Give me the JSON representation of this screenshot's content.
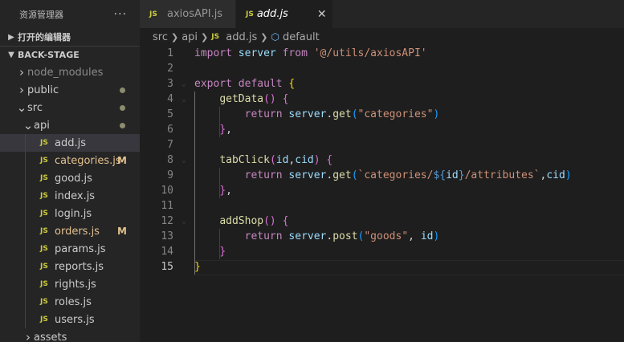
{
  "sidebar": {
    "title": "资源管理器",
    "more": "···",
    "open_editors": "打开的编辑器",
    "project": "BACK-STAGE",
    "tree": [
      {
        "label": "node_modules",
        "type": "folder",
        "depth": 0,
        "expanded": false,
        "muted": true
      },
      {
        "label": "public",
        "type": "folder",
        "depth": 0,
        "expanded": false,
        "dot": true
      },
      {
        "label": "src",
        "type": "folder",
        "depth": 0,
        "expanded": true,
        "dot": true
      },
      {
        "label": "api",
        "type": "folder",
        "depth": 1,
        "expanded": true,
        "dot": true
      },
      {
        "label": "add.js",
        "type": "js",
        "depth": 2,
        "selected": true
      },
      {
        "label": "categories.js",
        "type": "js",
        "depth": 2,
        "modified": true,
        "badge": "M"
      },
      {
        "label": "good.js",
        "type": "js",
        "depth": 2
      },
      {
        "label": "index.js",
        "type": "js",
        "depth": 2
      },
      {
        "label": "login.js",
        "type": "js",
        "depth": 2
      },
      {
        "label": "orders.js",
        "type": "js",
        "depth": 2,
        "modified": true,
        "badge": "M"
      },
      {
        "label": "params.js",
        "type": "js",
        "depth": 2
      },
      {
        "label": "reports.js",
        "type": "js",
        "depth": 2
      },
      {
        "label": "rights.js",
        "type": "js",
        "depth": 2
      },
      {
        "label": "roles.js",
        "type": "js",
        "depth": 2
      },
      {
        "label": "users.js",
        "type": "js",
        "depth": 2
      },
      {
        "label": "assets",
        "type": "folder",
        "depth": 1,
        "expanded": false
      }
    ]
  },
  "tabs": [
    {
      "icon": "JS",
      "label": "axiosAPI.js",
      "active": false
    },
    {
      "icon": "JS",
      "label": "add.js",
      "active": true,
      "close": "✕"
    }
  ],
  "breadcrumb": {
    "parts": [
      "src",
      "api",
      "add.js",
      "default"
    ],
    "js_icon": "JS"
  },
  "code": {
    "current_line": 15,
    "lines": [
      {
        "n": "1",
        "tokens": [
          [
            "kw",
            "import"
          ],
          [
            "op",
            " "
          ],
          [
            "var",
            "server"
          ],
          [
            "op",
            " "
          ],
          [
            "kw",
            "from"
          ],
          [
            "op",
            " "
          ],
          [
            "str",
            "'@/utils/axiosAPI'"
          ]
        ]
      },
      {
        "n": "2",
        "tokens": []
      },
      {
        "n": "3",
        "fold": true,
        "tokens": [
          [
            "kw",
            "export"
          ],
          [
            "op",
            " "
          ],
          [
            "kw",
            "default"
          ],
          [
            "op",
            " "
          ],
          [
            "br1",
            "{"
          ]
        ]
      },
      {
        "n": "4",
        "fold": true,
        "tokens": [
          [
            "op",
            "    "
          ],
          [
            "fn",
            "getData"
          ],
          [
            "br2",
            "()"
          ],
          [
            "op",
            " "
          ],
          [
            "br2",
            "{"
          ]
        ]
      },
      {
        "n": "5",
        "tokens": [
          [
            "op",
            "        "
          ],
          [
            "ctl",
            "return"
          ],
          [
            "op",
            " "
          ],
          [
            "var",
            "server"
          ],
          [
            "op",
            "."
          ],
          [
            "fn",
            "get"
          ],
          [
            "br3",
            "("
          ],
          [
            "str",
            "\"categories\""
          ],
          [
            "br3",
            ")"
          ]
        ]
      },
      {
        "n": "6",
        "tokens": [
          [
            "op",
            "    "
          ],
          [
            "br2",
            "}"
          ],
          [
            "op",
            ","
          ]
        ]
      },
      {
        "n": "7",
        "tokens": []
      },
      {
        "n": "8",
        "fold": true,
        "tokens": [
          [
            "op",
            "    "
          ],
          [
            "fn",
            "tabClick"
          ],
          [
            "br2",
            "("
          ],
          [
            "var",
            "id"
          ],
          [
            "op",
            ","
          ],
          [
            "var",
            "cid"
          ],
          [
            "br2",
            ")"
          ],
          [
            "op",
            " "
          ],
          [
            "br2",
            "{"
          ]
        ]
      },
      {
        "n": "9",
        "tokens": [
          [
            "op",
            "        "
          ],
          [
            "ctl",
            "return"
          ],
          [
            "op",
            " "
          ],
          [
            "var",
            "server"
          ],
          [
            "op",
            "."
          ],
          [
            "fn",
            "get"
          ],
          [
            "br3",
            "("
          ],
          [
            "str",
            "`categories/"
          ],
          [
            "tmpl",
            "${"
          ],
          [
            "var",
            "id"
          ],
          [
            "tmpl",
            "}"
          ],
          [
            "str",
            "/attributes`"
          ],
          [
            "op",
            ","
          ],
          [
            "var",
            "cid"
          ],
          [
            "br3",
            ")"
          ]
        ]
      },
      {
        "n": "10",
        "tokens": [
          [
            "op",
            "    "
          ],
          [
            "br2",
            "}"
          ],
          [
            "op",
            ","
          ]
        ]
      },
      {
        "n": "11",
        "tokens": []
      },
      {
        "n": "12",
        "fold": true,
        "tokens": [
          [
            "op",
            "    "
          ],
          [
            "fn",
            "addShop"
          ],
          [
            "br2",
            "()"
          ],
          [
            "op",
            " "
          ],
          [
            "br2",
            "{"
          ]
        ]
      },
      {
        "n": "13",
        "tokens": [
          [
            "op",
            "        "
          ],
          [
            "ctl",
            "return"
          ],
          [
            "op",
            " "
          ],
          [
            "var",
            "server"
          ],
          [
            "op",
            "."
          ],
          [
            "fn",
            "post"
          ],
          [
            "br3",
            "("
          ],
          [
            "str",
            "\"goods\""
          ],
          [
            "op",
            ", "
          ],
          [
            "var",
            "id"
          ],
          [
            "br3",
            ")"
          ]
        ]
      },
      {
        "n": "14",
        "tokens": [
          [
            "op",
            "    "
          ],
          [
            "br2",
            "}"
          ]
        ]
      },
      {
        "n": "15",
        "tokens": [
          [
            "br1",
            "}"
          ]
        ]
      }
    ]
  },
  "colors": {
    "sidebar_bg": "#252526",
    "editor_bg": "#1e1e1e",
    "js_icon": "#cbcb41",
    "modified": "#e2c08d",
    "selected_row": "#37373d"
  }
}
